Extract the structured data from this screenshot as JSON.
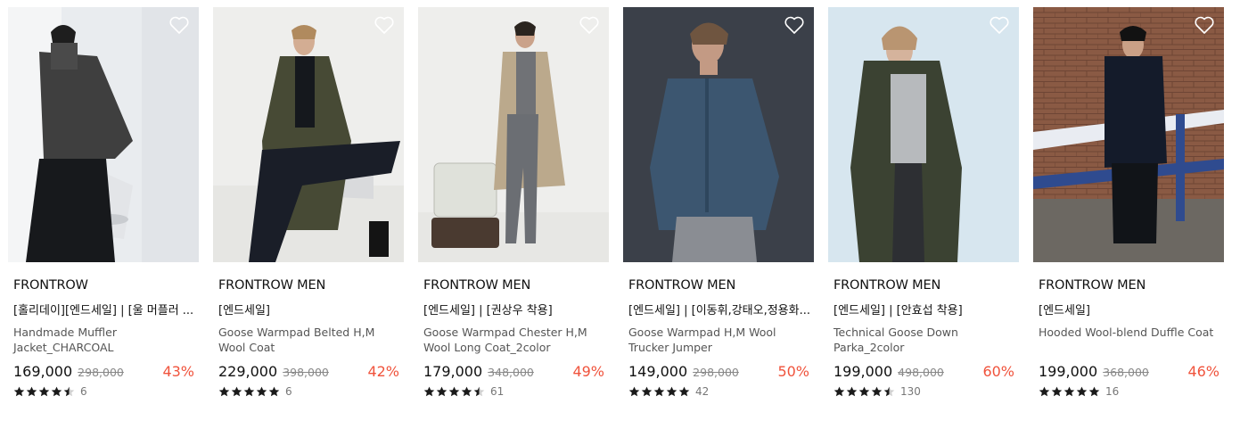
{
  "products": [
    {
      "brand": "FRONTROW",
      "tag": "[홀리데이][엔드세일] | [울 머플러 ...",
      "name": "Handmade Muffler Jacket_CHARCOAL",
      "price": "169,000",
      "original_price": "298,000",
      "discount": "43%",
      "rating": 4.5,
      "reviews": "6",
      "bg": "#e9ecef"
    },
    {
      "brand": "FRONTROW MEN",
      "tag": "[엔드세일]",
      "name": "Goose Warmpad Belted H,M Wool Coat",
      "price": "229,000",
      "original_price": "398,000",
      "discount": "42%",
      "rating": 5,
      "reviews": "6",
      "bg": "#eeeeec"
    },
    {
      "brand": "FRONTROW MEN",
      "tag": "[엔드세일] | [권상우 착용]",
      "name": "Goose Warmpad Chester H,M Wool Long Coat_2color",
      "price": "179,000",
      "original_price": "348,000",
      "discount": "49%",
      "rating": 4.5,
      "reviews": "61",
      "bg": "#eeeeec"
    },
    {
      "brand": "FRONTROW MEN",
      "tag": "[엔드세일] | [이동휘,강태오,정용화...",
      "name": "Goose Warmpad H,M Wool Trucker Jumper",
      "price": "149,000",
      "original_price": "298,000",
      "discount": "50%",
      "rating": 5,
      "reviews": "42",
      "bg": "#3b4049"
    },
    {
      "brand": "FRONTROW MEN",
      "tag": "[엔드세일] | [안효섭 착용]",
      "name": "Technical Goose Down Parka_2color",
      "price": "199,000",
      "original_price": "498,000",
      "discount": "60%",
      "rating": 4.5,
      "reviews": "130",
      "bg": "#d7e6ef"
    },
    {
      "brand": "FRONTROW MEN",
      "tag": "[엔드세일]",
      "name": "Hooded Wool-blend Duffle Coat",
      "price": "199,000",
      "original_price": "368,000",
      "discount": "46%",
      "rating": 5,
      "reviews": "16",
      "bg": "#8a5a44"
    }
  ],
  "colors": {
    "discount": "#f0533c",
    "heart_icon": "heart-outline-icon"
  }
}
